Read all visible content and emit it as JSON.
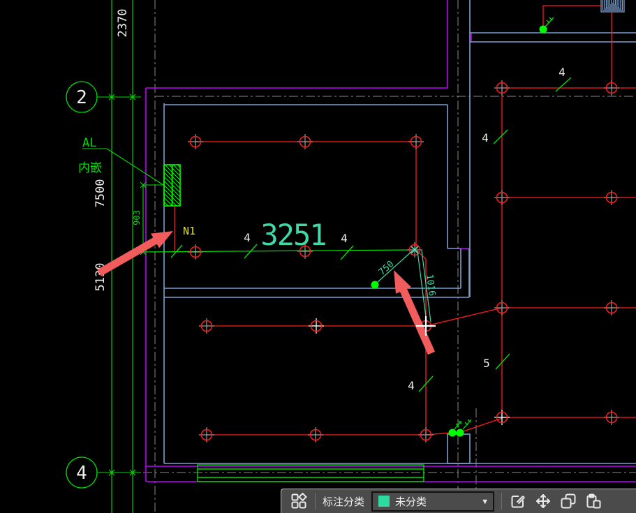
{
  "colors": {
    "background": "#000000",
    "wire_red": "#ff1a1a",
    "dim_green": "#00dd00",
    "device_green": "#00ff00",
    "selection_teal": "#3fd9a8",
    "wall_blue": "#7ba0cf",
    "wall_magenta": "#bf00ff",
    "centerline_gray": "#8a8a8a",
    "text_white": "#f0f0f0",
    "circuit_yellow": "#e6e600",
    "arrow_red": "#f25c5c",
    "toolbar_bg": "#4b4b4b"
  },
  "drawing": {
    "grid_axes": [
      {
        "label": "2"
      },
      {
        "label": "4"
      }
    ],
    "dim_chain": [
      {
        "value": "2370"
      },
      {
        "value": "7500"
      },
      {
        "value": "5130"
      },
      {
        "value": "903"
      }
    ],
    "panel": {
      "name": "AL",
      "mount": "内嵌",
      "circuit": "N1"
    },
    "selection": {
      "dim_main": "3251",
      "dim_a": "750",
      "dim_b": "1016"
    },
    "wire_counts": [
      {
        "value": "4"
      },
      {
        "value": "4"
      },
      {
        "value": "4"
      },
      {
        "value": "4"
      },
      {
        "value": "5"
      },
      {
        "value": "4"
      }
    ]
  },
  "toolbar": {
    "category_label": "标注分类",
    "selected_category": "未分类",
    "swatch_color": "#2ed9a2",
    "swatch_style": "background-color:#2ed9a2",
    "icon_names": [
      "category-grid-icon",
      "edit-annotation-icon",
      "move-icon",
      "copy-icon",
      "paste-icon",
      "dropdown-arrow-icon"
    ]
  }
}
